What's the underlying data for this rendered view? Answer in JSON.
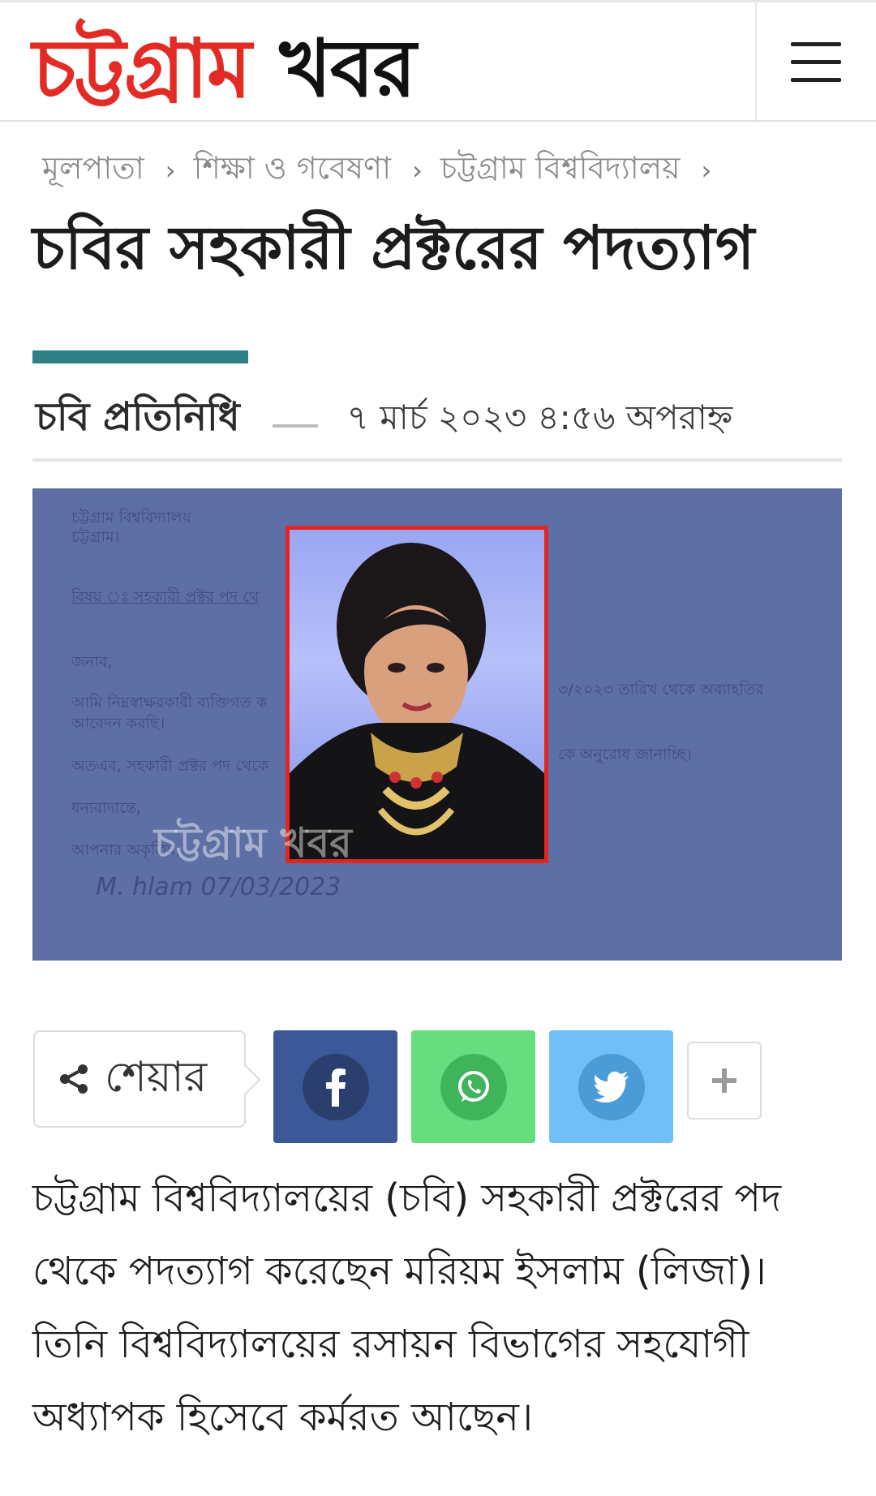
{
  "header": {
    "logo_part1": "চট্টগ্রাম",
    "logo_part2": "খবর",
    "menu_icon": "hamburger-menu-icon"
  },
  "breadcrumb": {
    "items": [
      "মূলপাতা",
      "শিক্ষা ও গবেষণা",
      "চট্টগ্রাম বিশ্ববিদ্যালয়"
    ],
    "separator": "›"
  },
  "article": {
    "title": "চবির সহকারী প্রক্টরের পদত্যাগ",
    "author": "চবি প্রতিনিধি",
    "date": "৭ মার্চ ২০২৩ ৪:৫৬ অপরাহ্ন",
    "accent_color": "#2f7f86",
    "body": "চট্টগ্রাম বিশ্ববিদ্যালয়ের (চবি) সহকারী প্রক্টরের পদ থেকে পদত্যাগ করেছেন মরিয়ম ইসলাম (লিজা)। তিনি বিশ্ববিদ্যালয়ের রসায়ন বিভাগের সহযোগী অধ্যাপক হিসেবে কর্মরত আছেন।"
  },
  "feature_image": {
    "background_color": "#5d6fa5",
    "frame_color": "#e0261f",
    "watermark": "চট্টগ্রাম খবর",
    "letter_lines": [
      "চট্টগ্রাম বিশ্ববিদ্যালয়",
      "চট্টগ্রাম।",
      "বিষয় ঃ সহকারী প্রক্টর পদ থে",
      "জনাব,",
      "আমি নিম্নস্বাক্ষরকারী ব্যক্তিগত ক",
      "৩/২০২৩ তারিখ থেকে অব্যাহতির",
      "আবেদন করছি।",
      "অতএব, সহকারী প্রক্টর পদ থেকে",
      "কে অনুরোধ জানাচ্ছি।",
      "ধন্যবাদান্তে,",
      "আপনার অকৃত্রিম,",
      "M. hlam   07/03/2023"
    ]
  },
  "share": {
    "label": "শেয়ার",
    "icon": "share-icon",
    "buttons": [
      {
        "name": "facebook",
        "icon": "facebook-icon",
        "color": "#3b5998"
      },
      {
        "name": "whatsapp",
        "icon": "whatsapp-icon",
        "color": "#68dd80"
      },
      {
        "name": "twitter",
        "icon": "twitter-icon",
        "color": "#71bff7"
      }
    ],
    "more_icon": "plus-icon"
  }
}
